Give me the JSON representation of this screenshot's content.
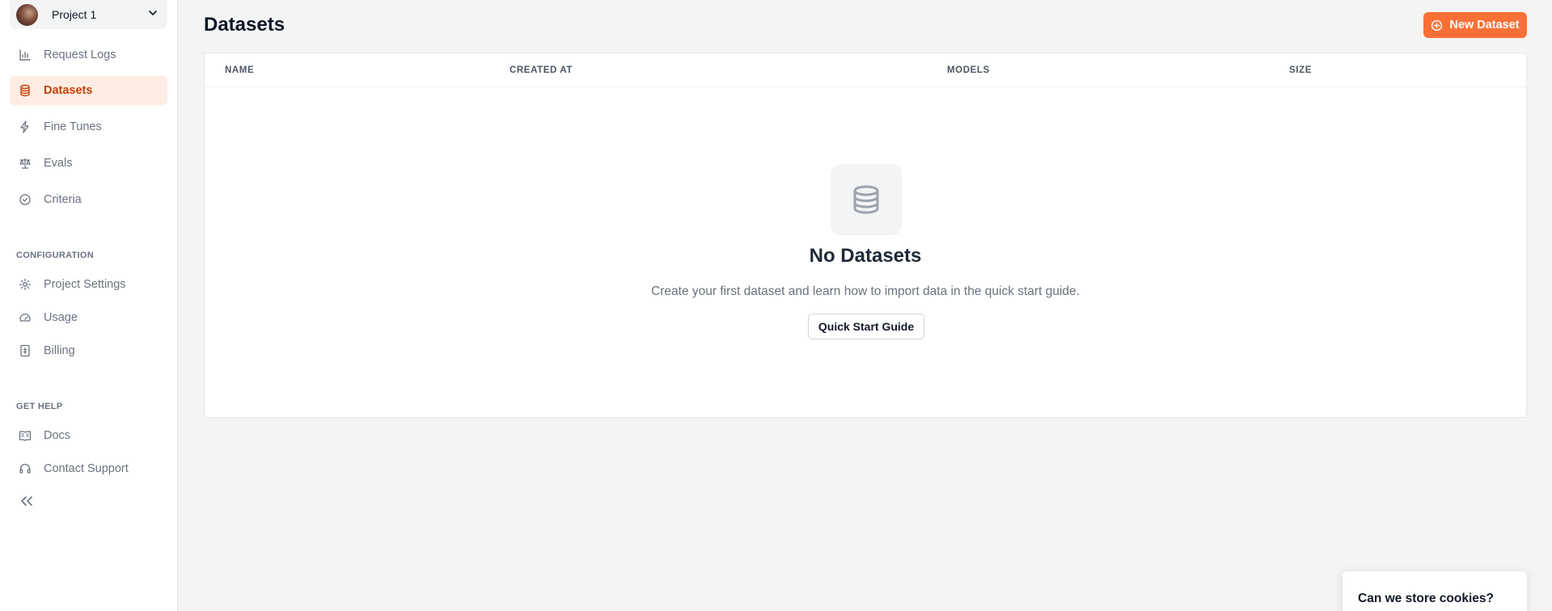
{
  "sidebar": {
    "project": {
      "name": "Project 1"
    },
    "nav": [
      {
        "label": "Request Logs",
        "icon": "bar-chart-icon",
        "active": false
      },
      {
        "label": "Datasets",
        "icon": "database-icon",
        "active": true
      },
      {
        "label": "Fine Tunes",
        "icon": "lightning-icon",
        "active": false
      },
      {
        "label": "Evals",
        "icon": "scale-icon",
        "active": false
      },
      {
        "label": "Criteria",
        "icon": "check-circle-icon",
        "active": false
      }
    ],
    "configuration_label": "CONFIGURATION",
    "configuration": [
      {
        "label": "Project Settings",
        "icon": "gear-icon"
      },
      {
        "label": "Usage",
        "icon": "gauge-icon"
      },
      {
        "label": "Billing",
        "icon": "receipt-icon"
      }
    ],
    "help_label": "GET HELP",
    "help": [
      {
        "label": "Docs",
        "icon": "book-icon"
      },
      {
        "label": "Contact Support",
        "icon": "headset-icon"
      }
    ]
  },
  "main": {
    "title": "Datasets",
    "new_button_label": "New Dataset",
    "table": {
      "columns": [
        "NAME",
        "CREATED AT",
        "MODELS",
        "SIZE"
      ]
    },
    "empty_state": {
      "title": "No Datasets",
      "description": "Create your first dataset and learn how to import data in the quick start guide.",
      "button_label": "Quick Start Guide"
    }
  },
  "cookie_banner": {
    "text": "Can we store cookies?"
  },
  "colors": {
    "accent": "#f97036",
    "active_bg": "#ffede4",
    "active_text": "#c2410c"
  }
}
